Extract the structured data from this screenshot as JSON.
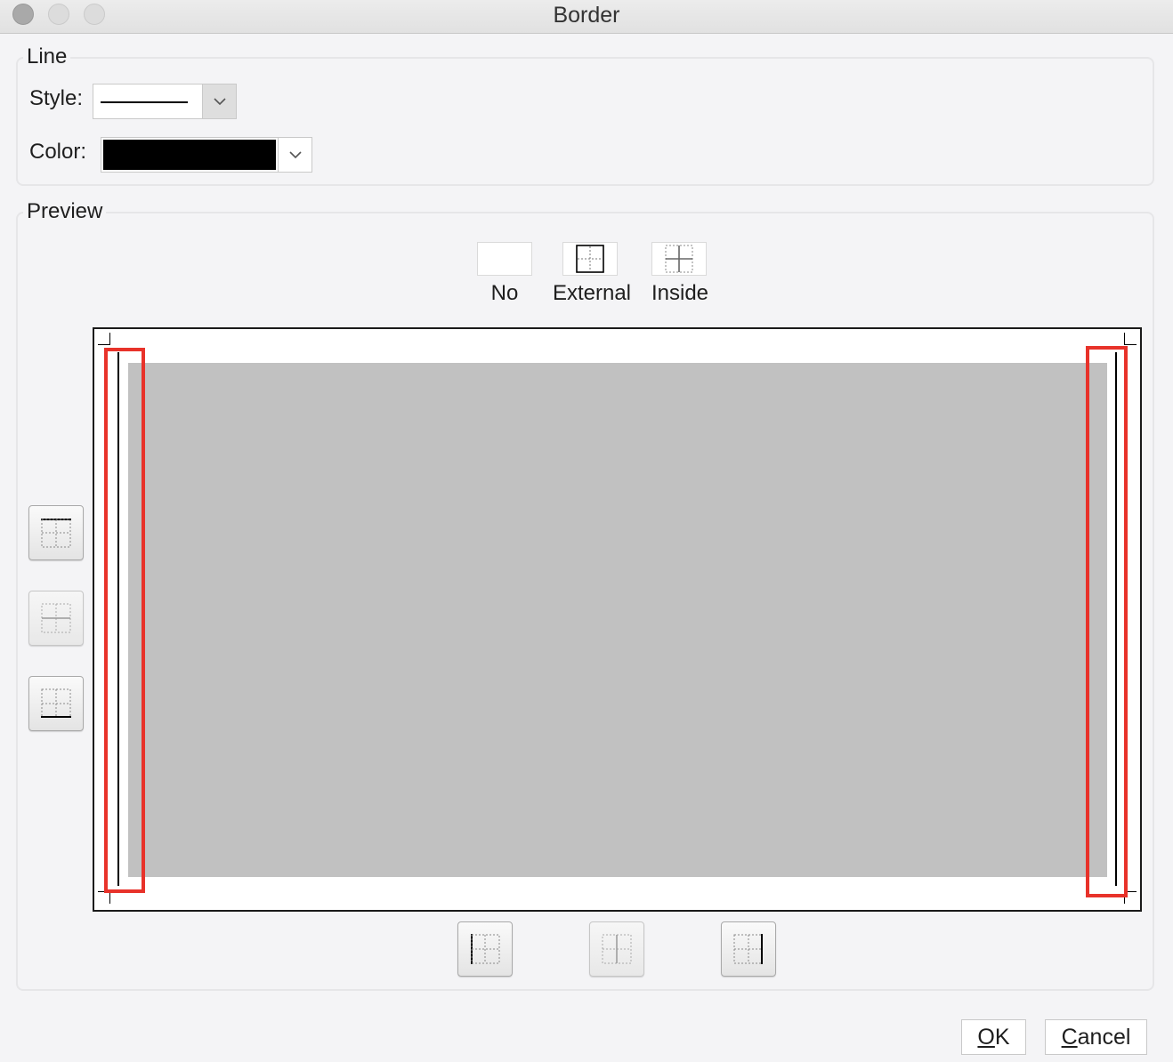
{
  "window": {
    "title": "Border"
  },
  "line_group": {
    "legend": "Line",
    "style_label": "Style:",
    "color_label": "Color:",
    "color_value": "#000000",
    "style_value": "solid"
  },
  "preview_group": {
    "legend": "Preview",
    "presets": [
      {
        "label": "No"
      },
      {
        "label": "External"
      },
      {
        "label": "Inside"
      }
    ]
  },
  "buttons": {
    "ok_mnemonic": "O",
    "ok_rest": "K",
    "cancel_mnemonic": "C",
    "cancel_rest": "ancel"
  },
  "colors": {
    "highlight": "#e8322a",
    "preview_fill": "#c1c1c1"
  }
}
